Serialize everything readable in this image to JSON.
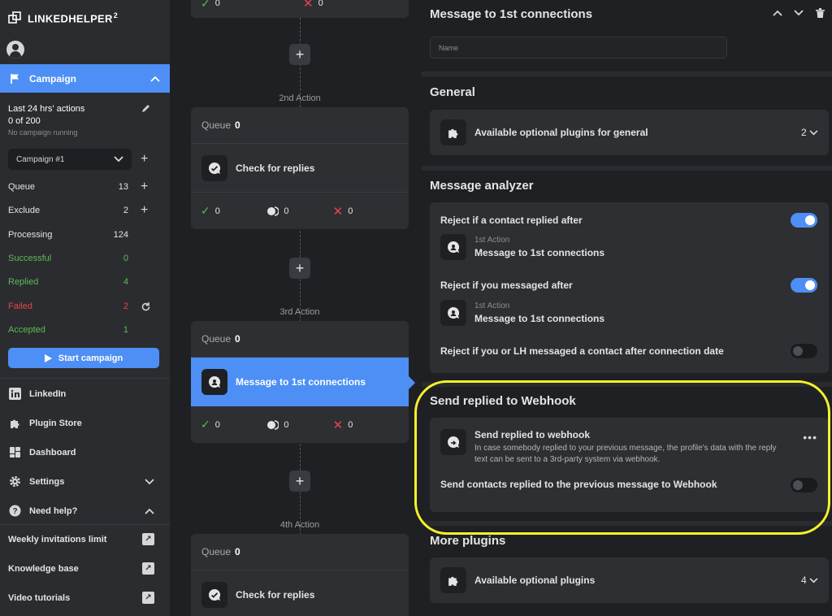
{
  "app": {
    "name": "LINKEDHELPER",
    "sup": "2"
  },
  "sidebar": {
    "campaign_label": "Campaign",
    "stats": {
      "title": "Last 24 hrs' actions",
      "count": "0 of 200",
      "status": "No campaign running"
    },
    "campaign_select": "Campaign #1",
    "rows": [
      {
        "label": "Queue",
        "value": "13",
        "color": "#e4e4e6"
      },
      {
        "label": "Exclude",
        "value": "2",
        "color": "#e4e4e6"
      },
      {
        "label": "Processing",
        "value": "124",
        "color": "#e4e4e6"
      },
      {
        "label": "Successful",
        "value": "0",
        "color": "#5cbb52"
      },
      {
        "label": "Replied",
        "value": "4",
        "color": "#5cbb52"
      },
      {
        "label": "Failed",
        "value": "2",
        "color": "#e2464c"
      },
      {
        "label": "Accepted",
        "value": "1",
        "color": "#5cbb52"
      }
    ],
    "start_button": "Start campaign",
    "nav": [
      {
        "label": "LinkedIn"
      },
      {
        "label": "Plugin Store"
      },
      {
        "label": "Dashboard"
      },
      {
        "label": "Settings"
      },
      {
        "label": "Need help?"
      }
    ],
    "help_links": [
      {
        "label": "Weekly invitations limit"
      },
      {
        "label": "Knowledge base"
      },
      {
        "label": "Video tutorials"
      }
    ]
  },
  "flow": {
    "top_partial": {
      "ok": "0",
      "fail": "0"
    },
    "actions": [
      {
        "label": "2nd Action",
        "queue_label": "Queue",
        "queue": "0",
        "name": "Check for replies",
        "ok": "0",
        "wait": "0",
        "fail": "0"
      },
      {
        "label": "3rd Action",
        "queue_label": "Queue",
        "queue": "0",
        "name": "Message to 1st connections",
        "ok": "0",
        "wait": "0",
        "fail": "0"
      },
      {
        "label": "4th Action",
        "queue_label": "Queue",
        "queue": "0",
        "name": "Check for replies"
      }
    ]
  },
  "panel": {
    "title": "Message to 1st connections",
    "name_placeholder": "Name",
    "general": {
      "title": "General",
      "plugins_label": "Available optional plugins for general",
      "count": "2"
    },
    "analyzer": {
      "title": "Message analyzer",
      "reject_replied": "Reject if a contact replied after",
      "reject_replied_ref_sub": "1st Action",
      "reject_replied_ref_name": "Message to 1st connections",
      "reject_messaged": "Reject if you messaged after",
      "reject_messaged_ref_sub": "1st Action",
      "reject_messaged_ref_name": "Message to 1st connections",
      "reject_lh": "Reject if you or LH messaged a contact after connection date"
    },
    "webhook": {
      "section_title": "Send replied to Webhook",
      "title": "Send replied to webhook",
      "description": "In case somebody replied to your previous message, the profile's data with the reply text can be sent to a 3rd-party system via webhook.",
      "option": "Send contacts replied to the previous message to Webhook"
    },
    "more": {
      "title": "More plugins",
      "plugins_label": "Available optional plugins",
      "count": "4"
    }
  },
  "colors": {
    "accent": "#4d8ff5",
    "success": "#5cbb52",
    "danger": "#e2464c",
    "highlight": "#f4f22b"
  }
}
